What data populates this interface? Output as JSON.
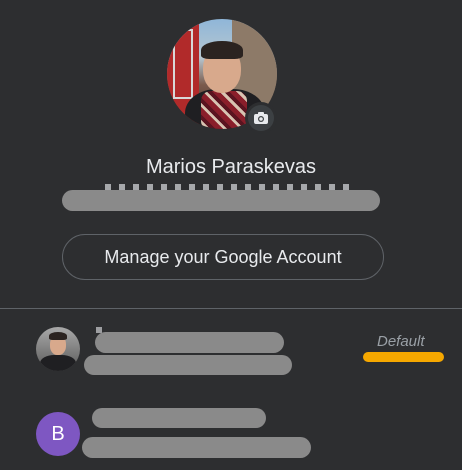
{
  "profile": {
    "name": "Marios Paraskevas",
    "camera_icon": "camera-icon"
  },
  "actions": {
    "manage_account_label": "Manage your Google Account"
  },
  "accounts": [
    {
      "status_label": "Default",
      "avatar": "photo"
    },
    {
      "avatar_letter": "B",
      "avatar_color": "#7e57c2"
    }
  ],
  "colors": {
    "background": "#2d2e30",
    "text": "#e8eaed",
    "divider": "#5f6368",
    "highlight": "#f6a800",
    "redaction": "#8a8a8a"
  }
}
